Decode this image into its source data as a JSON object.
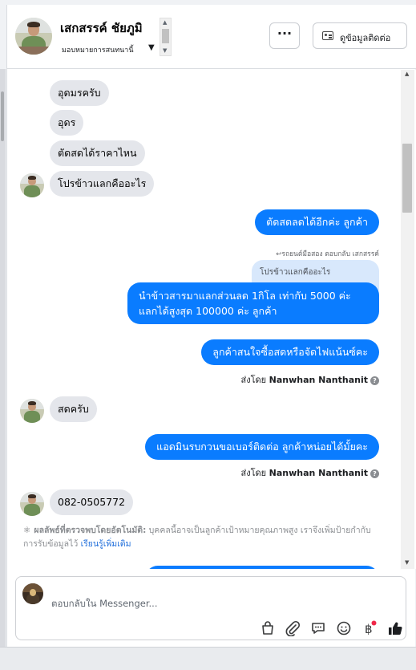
{
  "header": {
    "contact_name": "เสกสรรค์ ชัยภูมิ",
    "assign_label": "มอบหมายการสนทนานี้",
    "more_label": "···",
    "contact_info_label": "ดูข้อมูลติดต่อ"
  },
  "messages": {
    "in_1": "อุดมรครับ",
    "in_2": "อุดร",
    "in_3": "ตัดสดได้ราคาไหน",
    "in_4": "โปรข้าวแลกคืออะไร",
    "out_1": "ตัดสดลดได้อีกค่ะ ลูกค้า",
    "quote_meta": "รถยนต์มือสอง ตอบกลับ เสกสรรค์",
    "quote_text": "โปรข้าวแลกคืออะไร",
    "out_2_line1": "นำข้าวสารมาแลกส่วนลด 1กิโล เท่ากับ 5000 ค่ะ",
    "out_2_line2": "แลกได้สูงสุด 100000 ค่ะ ลูกค้า",
    "out_3": "ลูกค้าสนใจซื้อสดหรือจัดไฟแน้นซ์คะ",
    "sent_by_1_prefix": "ส่งโดย",
    "sent_by_1_name": "Nanwhan Nanthanit",
    "in_5": "สดครับ",
    "out_4": "แอดมินรบกวนขอเบอร์ติดต่อ ลูกค้าหน่อยได้มั้ยคะ",
    "sent_by_2_prefix": "ส่งโดย",
    "sent_by_2_name": "Nanwhan Nanthanit",
    "in_6": "082-0505772",
    "help_glyph": "?"
  },
  "auto_detect": {
    "title": "ผลลัพธ์ที่ตรวจพบโดยอัตโนมัติ:",
    "body": "บุคคลนี้อาจเป็นลูกค้าเป้าหมายคุณภาพสูง เราจึงเพิ่มป้ายกำกับการรับข้อมูลไว้",
    "link": "เรียนรู้เพิ่มเติม"
  },
  "composer": {
    "placeholder": "ตอบกลับใน Messenger..."
  },
  "icons": {
    "assign_caret": "chevron-down-icon",
    "contact": "contact-card-icon",
    "composer_tools": [
      "shopping-bag-icon",
      "attachment-icon",
      "saved-replies-icon",
      "emoji-icon",
      "baht-payment-icon",
      "thumbs-up-icon"
    ]
  },
  "colors": {
    "outgoing_bubble": "#0a7cff",
    "incoming_bubble": "#e4e6eb",
    "link": "#216fdb",
    "notification_dot": "#f02849"
  }
}
